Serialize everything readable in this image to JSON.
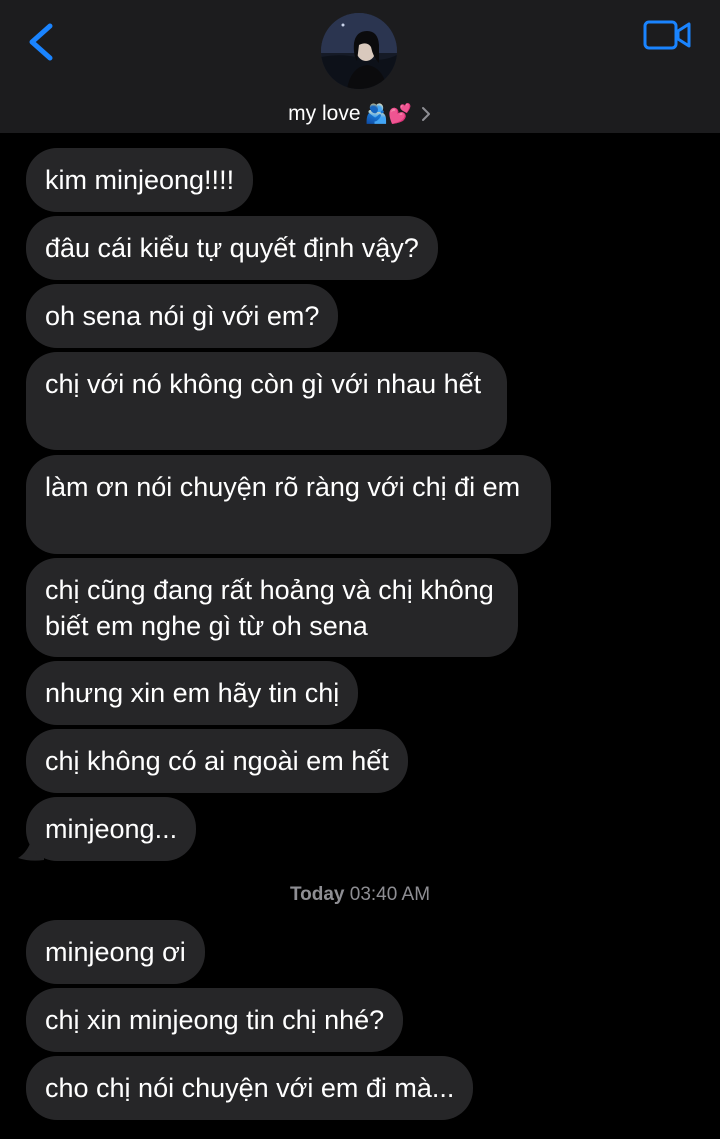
{
  "header": {
    "contact_name": "my love",
    "contact_emoji": "🫂💕",
    "back_icon": "chevron-left-icon",
    "video_icon": "video-camera-icon",
    "accent_color": "#1a84ff"
  },
  "messages_before": [
    "kim minjeong!!!!",
    "đâu cái kiểu tự quyết định vậy?",
    "oh sena nói gì với em?",
    "chị với nó không còn gì với nhau hết",
    "làm ơn nói chuyện rõ ràng với chị đi em",
    "chị cũng đang rất hoảng và chị không biết em nghe gì từ oh sena",
    "nhưng xin em hãy tin chị",
    "chị không có ai ngoài em hết",
    "minjeong..."
  ],
  "timestamp": {
    "day": "Today",
    "time": "03:40 AM"
  },
  "messages_after": [
    "minjeong ơi",
    "chị xin minjeong tin chị nhé?",
    "cho chị nói chuyện với em đi mà..."
  ]
}
